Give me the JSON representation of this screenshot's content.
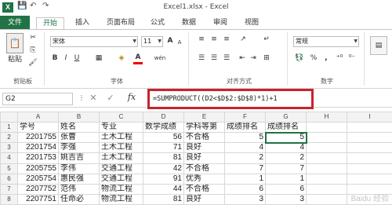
{
  "title": "Excel1.xlsx - Excel",
  "quick_access": {
    "app_icon": "X",
    "save": "💾",
    "undo": "↶",
    "redo": "↷"
  },
  "tabs": {
    "file": "文件",
    "home": "开始",
    "insert": "插入",
    "page_layout": "页面布局",
    "formulas": "公式",
    "data": "数据",
    "review": "审阅",
    "view": "视图"
  },
  "clipboard": {
    "paste": "粘贴",
    "group": "剪贴板"
  },
  "font": {
    "name": "宋体",
    "size": "11",
    "bold": "B",
    "italic": "I",
    "underline": "U",
    "grow": "A",
    "shrink": "A",
    "color_glyph": "A",
    "phonetic": "wén",
    "group": "字体"
  },
  "alignment": {
    "group": "对齐方式"
  },
  "number": {
    "format": "常规",
    "percent": "%",
    "comma": ",",
    "group": "数字"
  },
  "formula_bar": {
    "name_box": "G2",
    "fx": "fx",
    "formula": "=SUMPRODUCT((D2<$D$2:$D$8)*1)+1"
  },
  "columns": [
    "A",
    "B",
    "C",
    "D",
    "E",
    "F",
    "G",
    "H",
    "I"
  ],
  "rows": [
    {
      "n": "1",
      "a": "学号",
      "b": "姓名",
      "c": "专业",
      "d": "数学成绩",
      "e": "学科等第",
      "f": "成绩排名",
      "g": "成绩排名"
    },
    {
      "n": "2",
      "a": "2201755",
      "b": "张曹",
      "c": "土木工程",
      "d": "56",
      "e": "不合格",
      "f": "5",
      "g": "5"
    },
    {
      "n": "3",
      "a": "2201754",
      "b": "李强",
      "c": "土木工程",
      "d": "71",
      "e": "良好",
      "f": "4",
      "g": "4"
    },
    {
      "n": "4",
      "a": "2201753",
      "b": "姚吉吉",
      "c": "土木工程",
      "d": "81",
      "e": "良好",
      "f": "2",
      "g": "2"
    },
    {
      "n": "5",
      "a": "2205755",
      "b": "李伟",
      "c": "交通工程",
      "d": "42",
      "e": "不合格",
      "f": "7",
      "g": "7"
    },
    {
      "n": "6",
      "a": "2205754",
      "b": "惠民强",
      "c": "交通工程",
      "d": "91",
      "e": "优秀",
      "f": "1",
      "g": "1"
    },
    {
      "n": "7",
      "a": "2207752",
      "b": "范伟",
      "c": "物流工程",
      "d": "44",
      "e": "不合格",
      "f": "6",
      "g": "6"
    },
    {
      "n": "8",
      "a": "2207751",
      "b": "任命必",
      "c": "物流工程",
      "d": "81",
      "e": "良好",
      "f": "3",
      "g": "3"
    }
  ],
  "watermark": "Baidu 经验"
}
